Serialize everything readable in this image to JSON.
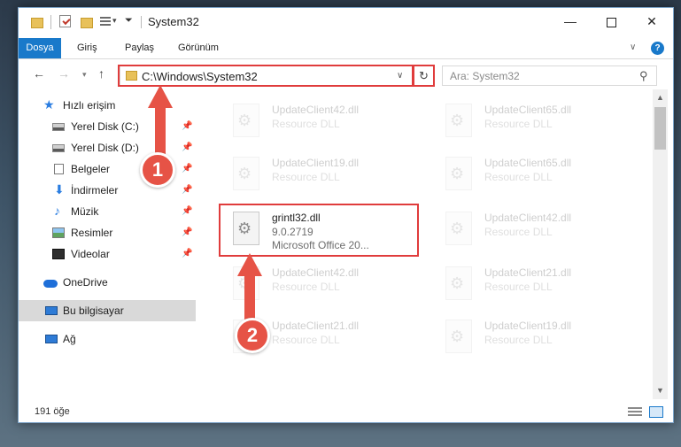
{
  "window": {
    "title": "System32",
    "controls": {
      "minimize": "—",
      "maximize": "",
      "close": "✕"
    }
  },
  "ribbon": {
    "tabs": [
      "Dosya",
      "Giriş",
      "Paylaş",
      "Görünüm"
    ]
  },
  "nav": {
    "address": "C:\\Windows\\System32",
    "search_placeholder": "Ara: System32"
  },
  "sidebar": {
    "items": [
      {
        "label": "Hızlı erişim",
        "icon": "star-icon"
      },
      {
        "label": "Yerel Disk (C:)",
        "icon": "drive-icon",
        "pinned": true
      },
      {
        "label": "Yerel Disk (D:)",
        "icon": "drive-icon",
        "pinned": true
      },
      {
        "label": "Belgeler",
        "icon": "documents-icon",
        "pinned": true
      },
      {
        "label": "İndirmeler",
        "icon": "download-icon",
        "pinned": true
      },
      {
        "label": "Müzik",
        "icon": "music-icon",
        "pinned": true
      },
      {
        "label": "Resimler",
        "icon": "pictures-icon",
        "pinned": true
      },
      {
        "label": "Videolar",
        "icon": "videos-icon",
        "pinned": true
      },
      {
        "label": "OneDrive",
        "icon": "cloud-icon"
      },
      {
        "label": "Bu bilgisayar",
        "icon": "computer-icon",
        "selected": true
      },
      {
        "label": "Ağ",
        "icon": "network-icon"
      }
    ]
  },
  "files": [
    {
      "name": "UpdateClient42.dll",
      "type": "Resource DLL",
      "faded": true
    },
    {
      "name": "UpdateClient65.dll",
      "type": "Resource DLL",
      "faded": true
    },
    {
      "name": "UpdateClient19.dll",
      "type": "Resource DLL",
      "faded": true
    },
    {
      "name": "UpdateClient65.dll",
      "type": "Resource DLL",
      "faded": true
    },
    {
      "name": "grintl32.dll",
      "version": "9.0.2719",
      "type": "Microsoft Office 20...",
      "faded": false
    },
    {
      "name": "UpdateClient42.dll",
      "type": "Resource DLL",
      "faded": true
    },
    {
      "name": "UpdateClient42.dll",
      "type": "Resource DLL",
      "faded": true
    },
    {
      "name": "UpdateClient21.dll",
      "type": "Resource DLL",
      "faded": true
    },
    {
      "name": "UpdateClient21.dll",
      "type": "Resource DLL",
      "faded": true
    },
    {
      "name": "UpdateClient19.dll",
      "type": "Resource DLL",
      "faded": true
    }
  ],
  "status": {
    "count": "191 öğe"
  },
  "callouts": {
    "step1": "1",
    "step2": "2"
  },
  "colors": {
    "accent": "#1979ca",
    "highlight": "#e03c3c",
    "callout": "#e65346"
  }
}
